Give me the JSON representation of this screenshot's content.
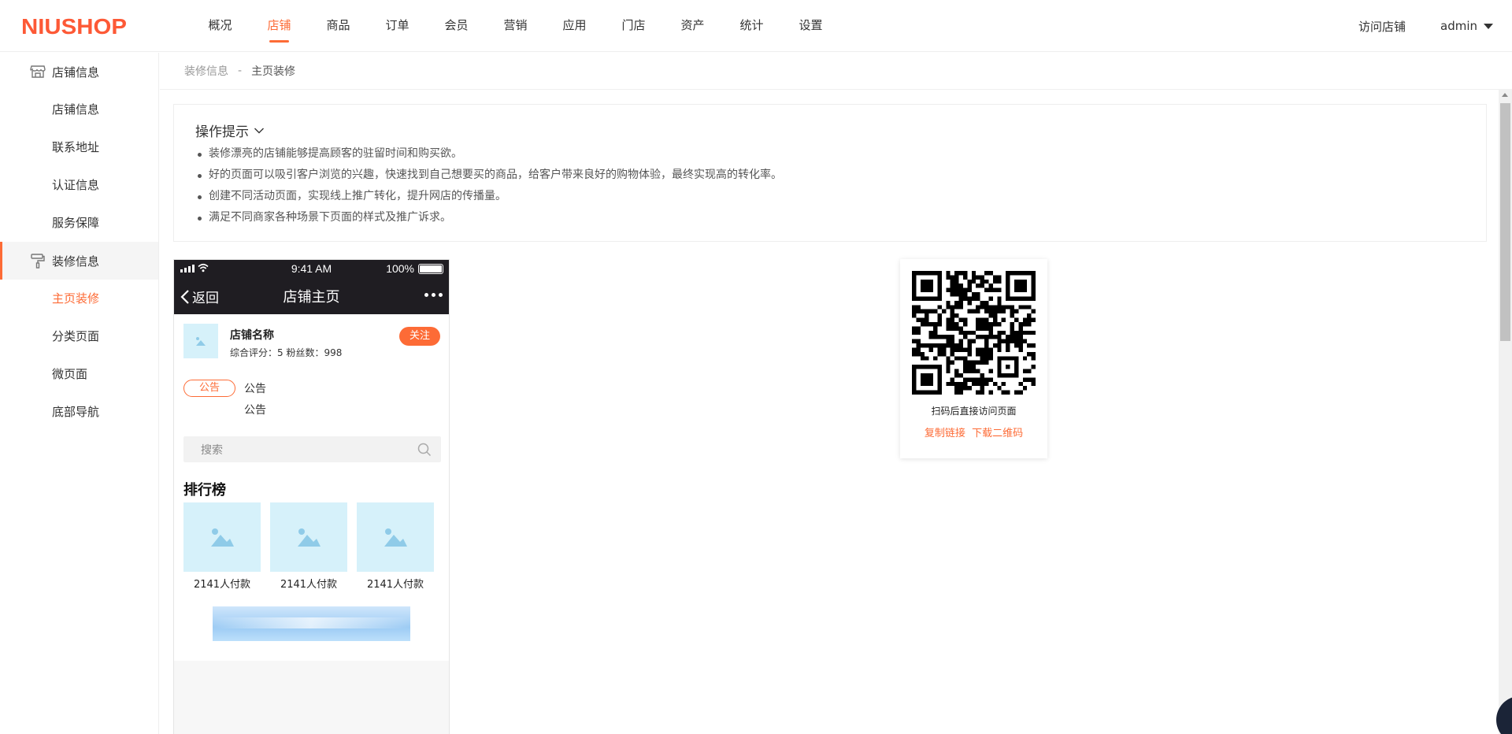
{
  "header": {
    "logo": "NIUSHOP",
    "nav": [
      {
        "label": "概况",
        "active": false
      },
      {
        "label": "店铺",
        "active": true
      },
      {
        "label": "商品",
        "active": false
      },
      {
        "label": "订单",
        "active": false
      },
      {
        "label": "会员",
        "active": false
      },
      {
        "label": "营销",
        "active": false
      },
      {
        "label": "应用",
        "active": false
      },
      {
        "label": "门店",
        "active": false
      },
      {
        "label": "资产",
        "active": false
      },
      {
        "label": "统计",
        "active": false
      },
      {
        "label": "设置",
        "active": false
      }
    ],
    "visit_store": "访问店铺",
    "user": "admin"
  },
  "sidebar": {
    "groups": [
      {
        "title": "店铺信息",
        "icon": "store-icon",
        "active": false,
        "items": [
          {
            "label": "店铺信息",
            "active": false
          },
          {
            "label": "联系地址",
            "active": false
          },
          {
            "label": "认证信息",
            "active": false
          },
          {
            "label": "服务保障",
            "active": false
          }
        ]
      },
      {
        "title": "装修信息",
        "icon": "paint-roller-icon",
        "active": true,
        "items": [
          {
            "label": "主页装修",
            "active": true
          },
          {
            "label": "分类页面",
            "active": false
          },
          {
            "label": "微页面",
            "active": false
          },
          {
            "label": "底部导航",
            "active": false
          }
        ]
      }
    ]
  },
  "breadcrumb": {
    "parent": "装修信息",
    "separator": "-",
    "current": "主页装修"
  },
  "tips": {
    "title": "操作提示",
    "items": [
      "装修漂亮的店铺能够提高顾客的驻留时间和购买欲。",
      "好的页面可以吸引客户浏览的兴趣，快速找到自己想要买的商品，给客户带来良好的购物体验，最终实现高的转化率。",
      "创建不同活动页面，实现线上推广转化，提升网店的传播量。",
      "满足不同商家各种场景下页面的样式及推广诉求。"
    ]
  },
  "phone": {
    "status": {
      "time": "9:41 AM",
      "battery": "100%"
    },
    "back_label": "返回",
    "title": "店铺主页",
    "shop": {
      "name": "店铺名称",
      "stats": "综合评分：5  粉丝数：998",
      "follow": "关注"
    },
    "notice": {
      "tag": "公告",
      "lines": [
        "公告",
        "公告"
      ]
    },
    "search": {
      "placeholder": "搜索"
    },
    "ranking": {
      "title": "排行榜",
      "items": [
        {
          "label": "2141人付款"
        },
        {
          "label": "2141人付款"
        },
        {
          "label": "2141人付款"
        }
      ]
    }
  },
  "qr": {
    "caption": "扫码后直接访问页面",
    "copy_link": "复制链接",
    "download": "下载二维码"
  },
  "colors": {
    "accent": "#fd6b36",
    "logo": "#fd5936",
    "phone_header": "#1f1d22",
    "placeholder_bg": "#d6f1fa"
  }
}
